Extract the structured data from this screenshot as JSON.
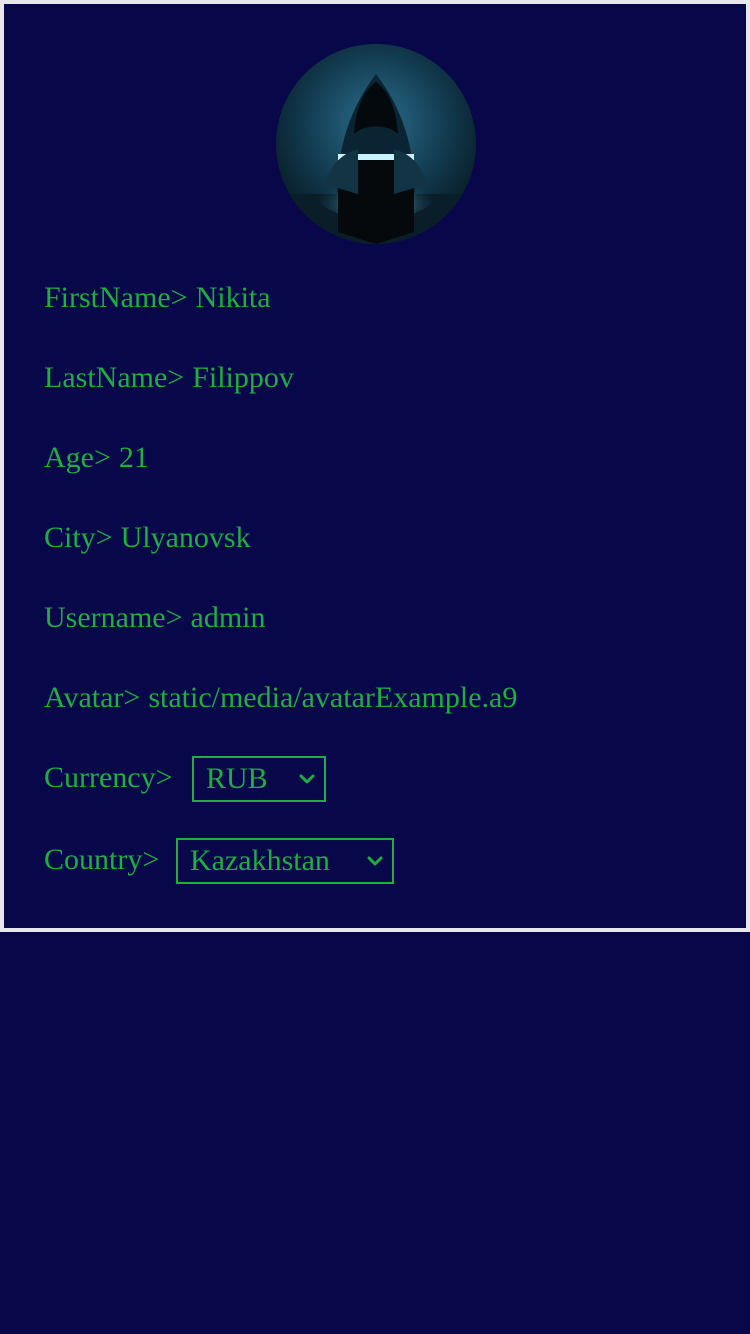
{
  "profile": {
    "firstname": {
      "label": "FirstName>",
      "value": "Nikita"
    },
    "lastname": {
      "label": "LastName>",
      "value": "Filippov"
    },
    "age": {
      "label": "Age>",
      "value": "21"
    },
    "city": {
      "label": "City>",
      "value": "Ulyanovsk"
    },
    "username": {
      "label": "Username>",
      "value": "admin"
    },
    "avatar": {
      "label": "Avatar>",
      "value": "static/media/avatarExample.a9"
    },
    "currency": {
      "label": "Currency>",
      "selected": "RUB"
    },
    "country": {
      "label": "Country>",
      "selected": "Kazakhstan"
    }
  },
  "colors": {
    "background": "#07074a",
    "text": "#1fae3f",
    "border": "#e6e6ee"
  },
  "icons": {
    "avatar": "hooded-hacker-avatar",
    "dropdown": "chevron-down-icon"
  }
}
